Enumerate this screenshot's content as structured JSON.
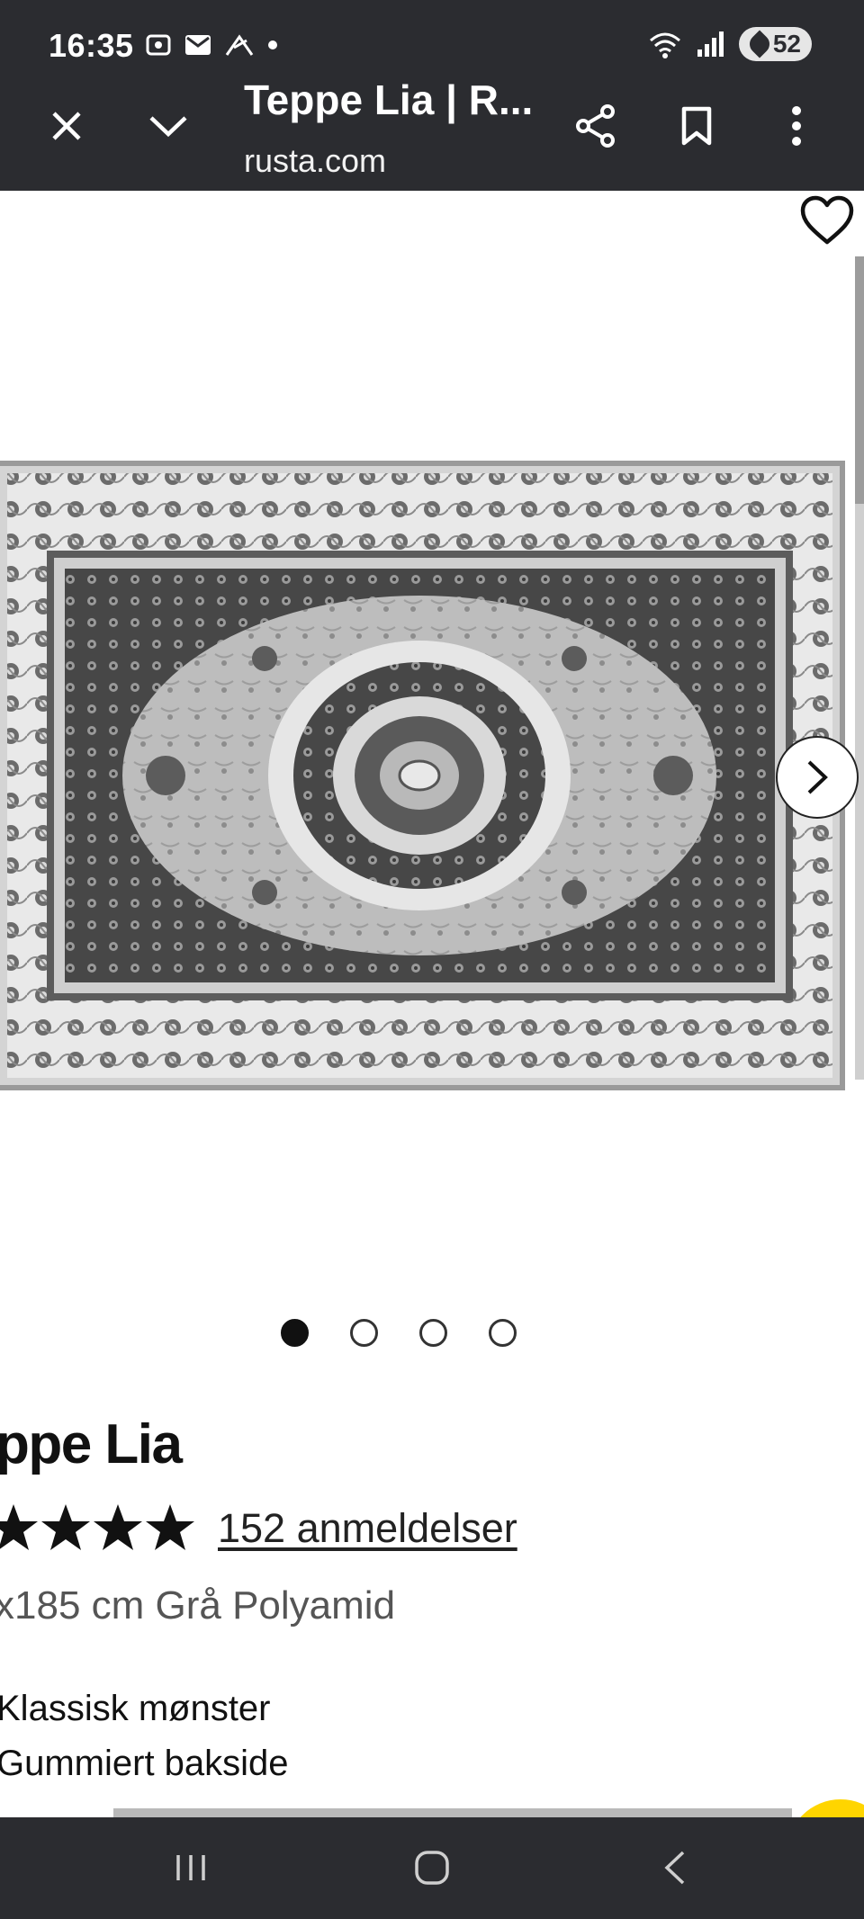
{
  "status_bar": {
    "time": "16:35",
    "battery": "52",
    "icons": [
      "screenshot-icon",
      "mail-icon",
      "notification-icon",
      "dot-icon",
      "wifi-icon",
      "signal-icon",
      "battery-icon"
    ]
  },
  "custom_tab": {
    "title": "Teppe Lia | R...",
    "url": "rusta.com",
    "icons": [
      "close-icon",
      "chevron-down-icon",
      "share-icon",
      "bookmark-icon",
      "more-vert-icon"
    ]
  },
  "product": {
    "title": "eppe Lia",
    "rating_stars": 4,
    "reviews_label": "152 anmeldelser",
    "variant": "x185 cm Grå Polyamid",
    "features": [
      "Klassisk mønster",
      "Gummiert bakside"
    ],
    "gallery": {
      "total_images": 4,
      "active_index": 0
    }
  },
  "colors": {
    "chrome": "#2b2c30",
    "accent_yellow": "#ffd500",
    "rug_light": "#c9c9c9",
    "rug_dark": "#4a4a4a"
  },
  "nav_bar": {
    "icons": [
      "recent-apps-icon",
      "home-icon",
      "back-icon"
    ]
  }
}
